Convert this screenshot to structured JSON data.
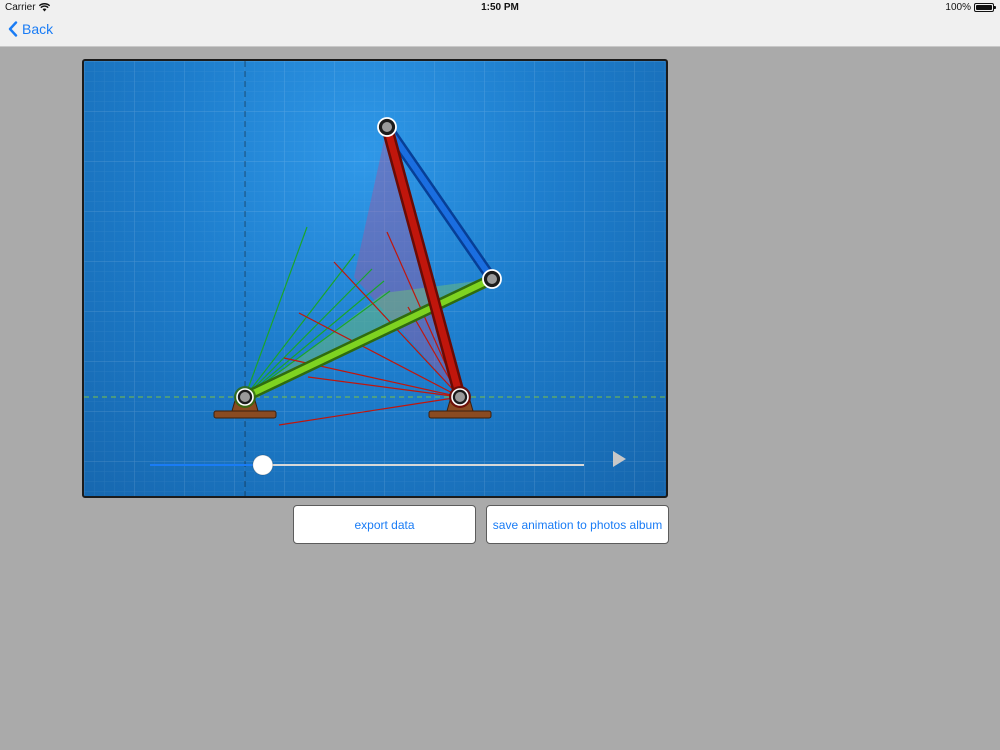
{
  "status_bar": {
    "carrier": "Carrier",
    "time": "1:50 PM",
    "battery": "100%"
  },
  "nav": {
    "back_label": "Back"
  },
  "animation": {
    "progress": 0.26
  },
  "buttons": {
    "export_label": "export data",
    "save_label": "save animation to photos album"
  },
  "colors": {
    "accent": "#1a7cf5",
    "link_ground": "#8a4b22",
    "link_input": "#7ed321",
    "link_coupler": "#0a56c8",
    "link_output": "#c0160c"
  }
}
